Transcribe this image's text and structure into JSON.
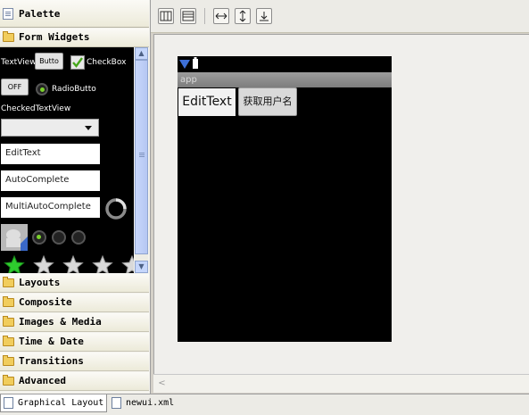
{
  "palette": {
    "header": "Palette",
    "form_widgets": "Form Widgets",
    "categories": [
      "Layouts",
      "Composite",
      "Images & Media",
      "Time & Date",
      "Transitions",
      "Advanced"
    ],
    "widgets": {
      "textview": "TextView",
      "button": "Butto",
      "checkbox": "CheckBox",
      "toggle": "OFF",
      "radiobutton": "RadioButto",
      "checkedtextview": "CheckedTextView",
      "edittext": "EditText",
      "autocomplete": "AutoComplete",
      "multiautocomplete": "MultiAutoComplete"
    },
    "rating_filled_stars": 1
  },
  "phone": {
    "app_title": "app",
    "edittext": "EditText",
    "button": "获取用户名"
  },
  "tabs": {
    "graphical": "Graphical Layout",
    "xml": "newui.xml"
  },
  "colors": {
    "rating_star": "#2ecc2e",
    "radio_selected": "#7bd12c",
    "status_icon": "#3d6fd6"
  }
}
